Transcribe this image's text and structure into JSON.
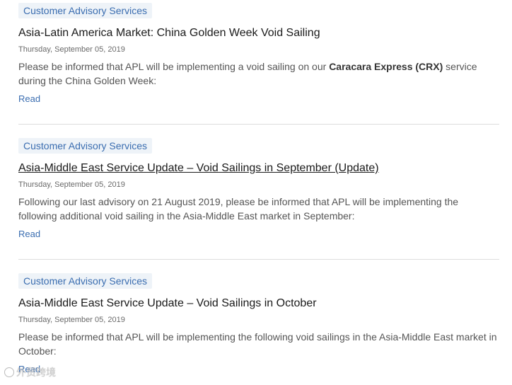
{
  "articles": [
    {
      "tag": "Customer Advisory Services",
      "title": "Asia-Latin America Market: China Golden Week Void Sailing",
      "date": "Thursday, September 05, 2019",
      "body_pre": "Please be informed that APL will be implementing a void sailing on our ",
      "body_bold": "Caracara Express (CRX)",
      "body_post": " service during the China Golden Week:",
      "read_label": "Read"
    },
    {
      "tag": "Customer Advisory Services",
      "title": "Asia-Middle East Service Update – Void Sailings in September (Update)",
      "date": "Thursday, September 05, 2019",
      "body": "Following our last advisory on 21 August 2019, please be informed that APL will be implementing the following additional void sailing in the Asia-Middle East market in September:",
      "read_label": "Read"
    },
    {
      "tag": "Customer Advisory Services",
      "title": "Asia-Middle East Service Update – Void Sailings in October",
      "date": "Thursday, September 05, 2019",
      "body": "Please be informed that APL will be implementing the following void sailings in the Asia-Middle East market in October:",
      "read_label": "Read"
    }
  ],
  "watermark": {
    "text": "外贸跨境"
  }
}
